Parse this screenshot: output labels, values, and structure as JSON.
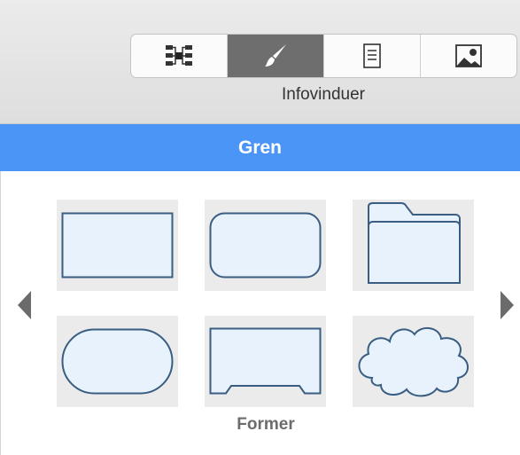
{
  "toolbar": {
    "tabs": [
      {
        "icon": "mindmap-icon",
        "active": false
      },
      {
        "icon": "brush-icon",
        "active": true
      },
      {
        "icon": "document-icon",
        "active": false
      },
      {
        "icon": "image-icon",
        "active": false
      }
    ],
    "label": "Infovinduer"
  },
  "header": {
    "title": "Gren"
  },
  "shapes": {
    "items": [
      {
        "name": "rectangle"
      },
      {
        "name": "rounded-rectangle"
      },
      {
        "name": "folder"
      },
      {
        "name": "stadium"
      },
      {
        "name": "notched-rectangle"
      },
      {
        "name": "cloud"
      }
    ],
    "label": "Former",
    "colors": {
      "fill": "#e8f2fd",
      "stroke": "#3a5d82",
      "tile": "#ebebeb"
    }
  }
}
